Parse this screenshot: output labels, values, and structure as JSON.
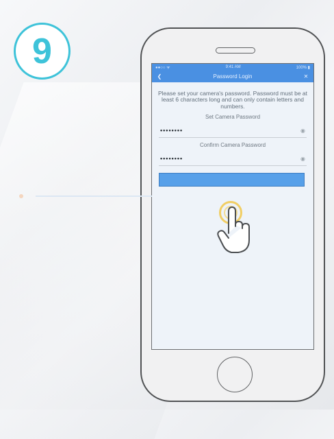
{
  "step": {
    "number": "9",
    "accent_color": "#3ec3d9"
  },
  "app": {
    "status_bar": {
      "left": "●●○○ ᯤ",
      "center": "9:41 AM",
      "right": "100% ▮"
    },
    "nav": {
      "title": "Password Login",
      "back_icon": "back-arrow-icon",
      "close_icon": "close-icon"
    },
    "instructions": "Please set your camera's password. Password must be at least 6 characters long and can only contain letters and numbers.",
    "set_password": {
      "label": "Set Camera Password",
      "value": "••••••••"
    },
    "confirm_password": {
      "label": "Confirm Camera Password",
      "value": "••••••••"
    },
    "confirm_button": {
      "label": ""
    },
    "brand_color": "#4a90e2"
  },
  "overlay": {
    "pointer_icon": "hand-pointer-icon",
    "tap_indicator_color": "#f1c232"
  }
}
